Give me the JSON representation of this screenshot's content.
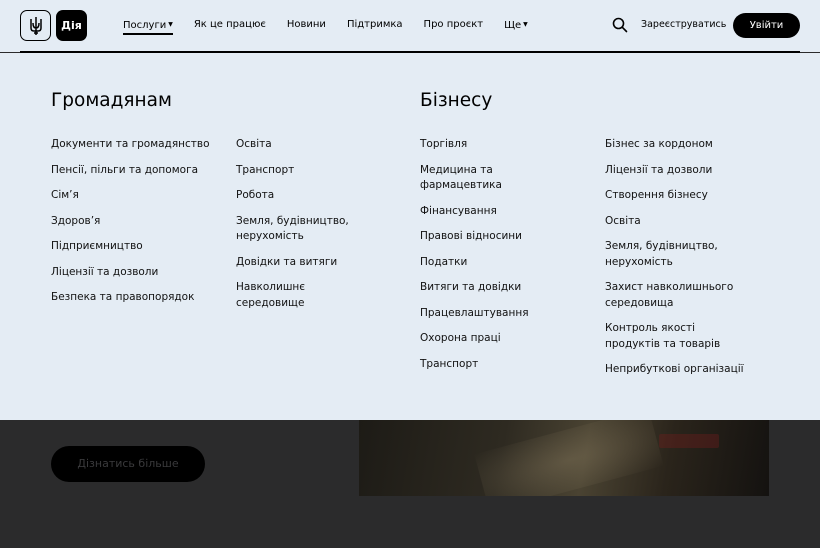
{
  "header": {
    "logo_diia": "Дія",
    "nav": [
      {
        "label": "Послуги",
        "has_caret": true,
        "active": true
      },
      {
        "label": "Як це працює"
      },
      {
        "label": "Новини"
      },
      {
        "label": "Підтримка"
      },
      {
        "label": "Про проєкт"
      },
      {
        "label": "Ще",
        "has_caret": true
      }
    ],
    "register_label": "Зареєструватись",
    "login_label": "Увійти"
  },
  "mega": {
    "citizens": {
      "title": "Громадянам",
      "col1": [
        "Документи та громадянство",
        "Пенсії, пільги та допомога",
        "Сім’я",
        "Здоров’я",
        "Підприємництво",
        "Ліцензії та дозволи",
        "Безпека та правопорядок"
      ],
      "col2": [
        "Освіта",
        "Транспорт",
        "Робота",
        "Земля, будівництво, нерухомість",
        "Довідки та витяги",
        "Навколишнє середовище"
      ]
    },
    "business": {
      "title": "Бізнесу",
      "col1": [
        "Торгівля",
        "Медицина та фармацевтика",
        "Фінансування",
        "Правові відносини",
        "Податки",
        "Витяги та довідки",
        "Працевлаштування",
        "Охорона праці",
        "Транспорт"
      ],
      "col2": [
        "Бізнес за кордоном",
        "Ліцензії та дозволи",
        "Створення бізнесу",
        "Освіта",
        "Земля, будівництво, нерухомість",
        "Захист навколишнього середовища",
        "Контроль якості продуктів та товарів",
        "Неприбуткові організації"
      ]
    }
  },
  "background": {
    "cta_label": "Дізнатись більше"
  }
}
